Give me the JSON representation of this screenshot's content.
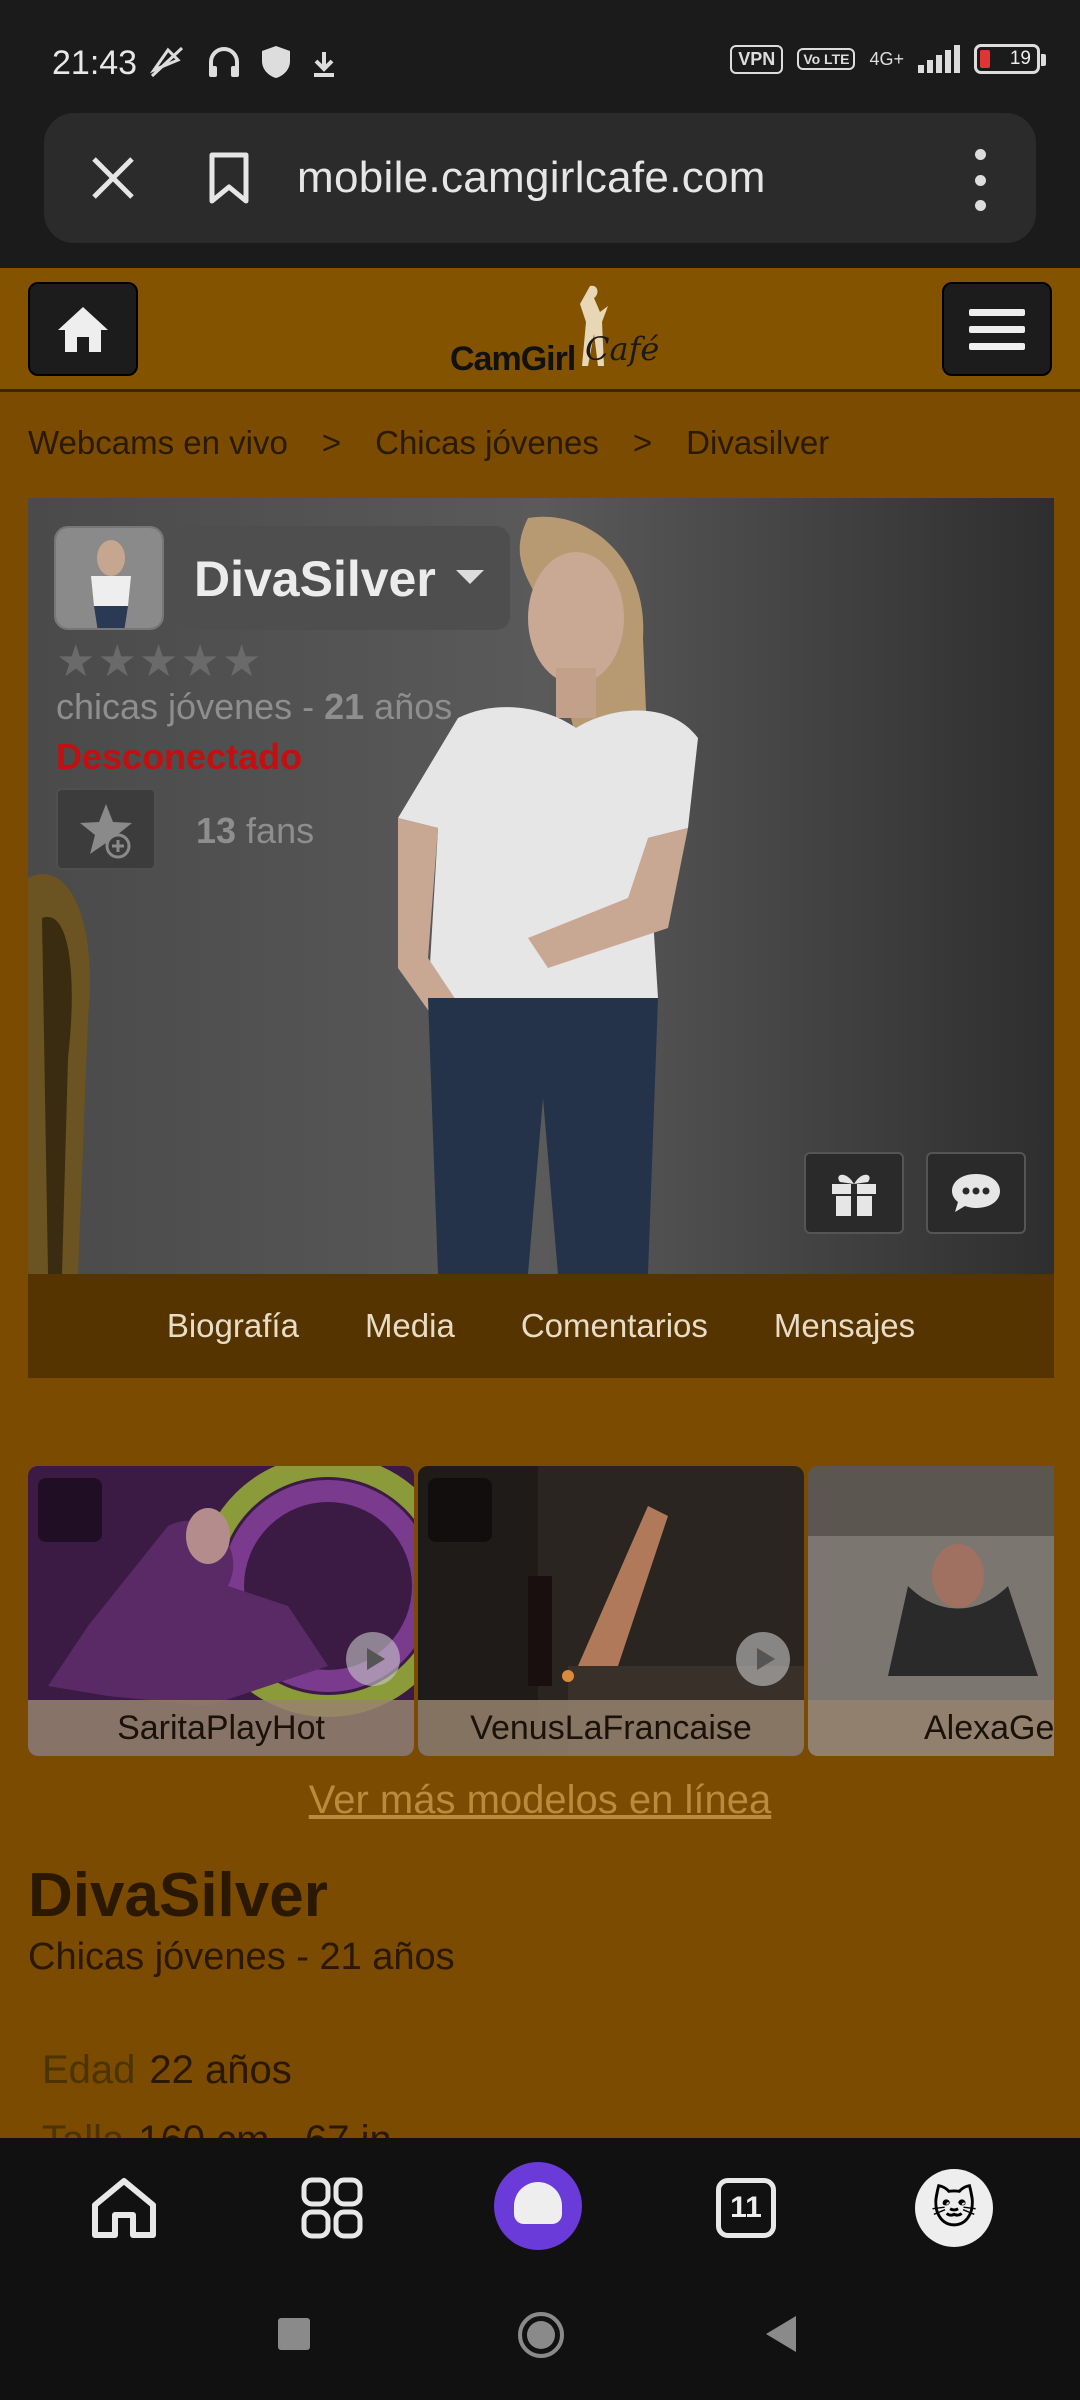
{
  "status_bar": {
    "time": "21:43",
    "vpn_label": "VPN",
    "volte_label": "Vo LTE",
    "network": "4G+",
    "battery": "19"
  },
  "browser": {
    "url": "mobile.camgirlcafe.com"
  },
  "site": {
    "logo_text": "CamGirl",
    "logo_script": "Café"
  },
  "breadcrumb": [
    "Webcams en vivo",
    ">",
    "Chicas jóvenes",
    ">",
    "Divasilver"
  ],
  "profile": {
    "name": "DivaSilver",
    "category": "chicas jóvenes - ",
    "age": "21",
    "age_unit": " años",
    "status": "Desconectado",
    "fans_count": "13",
    "fans_label": " fans",
    "rating": 0,
    "tabs": [
      "Biografía",
      "Media",
      "Comentarios",
      "Mensajes"
    ]
  },
  "carousel": [
    {
      "name": "SaritaPlayHot"
    },
    {
      "name": "VenusLaFrancaise"
    },
    {
      "name": "AlexaGe"
    }
  ],
  "more_models_link": "Ver más modelos en línea",
  "details": {
    "title": "DivaSilver",
    "subtitle": "Chicas jóvenes - 21 años",
    "rows": [
      {
        "key": "Edad",
        "value": "22 años"
      },
      {
        "key": "Talla",
        "value": "160 cm - 67 in"
      }
    ]
  },
  "bottom_nav": {
    "tab_count": "11"
  },
  "colors": {
    "page_bg": "#7a4b00",
    "header_bg": "#845300",
    "status_offline": "#c30f0f",
    "alice_purple": "#6a3bd8"
  }
}
